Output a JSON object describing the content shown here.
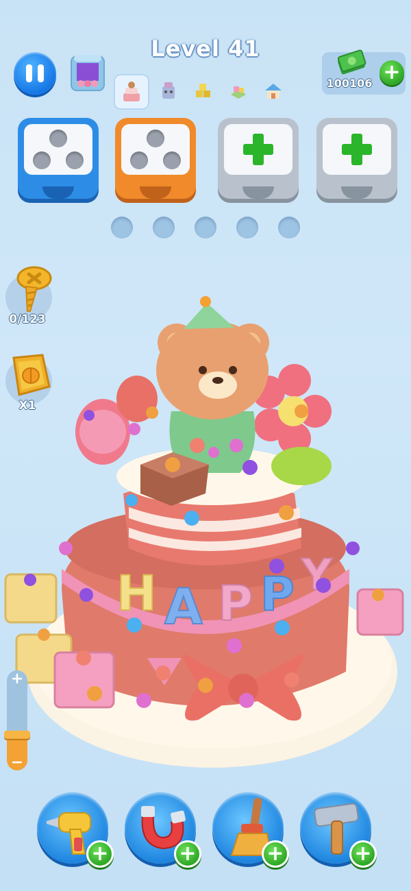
{
  "header": {
    "level_title": "Level 41",
    "pause_icon": "pause-icon",
    "house_icon": "house-icon",
    "stage_icons": [
      "cake-icon",
      "robot-icon",
      "blocks-icon",
      "toy-icon",
      "house-small-icon"
    ],
    "active_stage_index": 0,
    "cash_icon": "cash-icon",
    "cash_amount": "100106",
    "add_cash_label": "+"
  },
  "boxes": [
    {
      "color": "#2d8de6",
      "state": "filled",
      "holes": 3
    },
    {
      "color": "#f08a2a",
      "state": "filled",
      "holes": 3
    },
    {
      "color": "#b9c2cc",
      "state": "locked-add",
      "icon": "plus-icon"
    },
    {
      "color": "#b9c2cc",
      "state": "locked-add",
      "icon": "plus-icon"
    }
  ],
  "screw_slots": {
    "count": 5,
    "filled": 0
  },
  "side": {
    "screw_counter": "0/123",
    "screw_icon": "screw-icon",
    "booster_multiplier": "X1",
    "booster_icon": "pumpkin-coin-icon"
  },
  "zoom": {
    "plus": "+",
    "minus": "−",
    "level": 0.3
  },
  "scene": {
    "letters": [
      "H",
      "A",
      "P",
      "P",
      "Y"
    ]
  },
  "tools": [
    {
      "icon": "drill-icon",
      "add": "+"
    },
    {
      "icon": "magnet-icon",
      "add": "+"
    },
    {
      "icon": "broom-icon",
      "add": "+"
    },
    {
      "icon": "hammer-icon",
      "add": "+"
    }
  ],
  "colors": {
    "accent_blue": "#1f86e0",
    "accent_green": "#2fa826",
    "accent_orange": "#f08a2a",
    "background": "#c9e3f6"
  }
}
